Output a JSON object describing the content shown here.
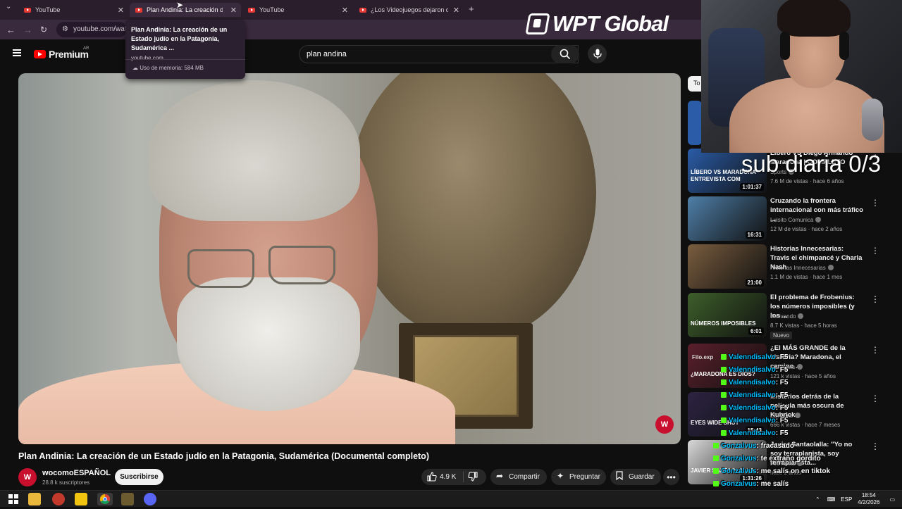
{
  "browser": {
    "tabs": [
      {
        "label": "YouTube"
      },
      {
        "label": "Plan Andinia: La creación de un Estado judío"
      },
      {
        "label": "YouTube"
      },
      {
        "label": "¿Los Videojuegos dejaron de Entretener?"
      }
    ],
    "url": "youtube.com/watch?v=",
    "tooltip": {
      "title": "Plan Andinia: La creación de un Estado judío en la Patagonia, Sudamérica ...",
      "domain": "youtube.com",
      "memory": "Uso de memoria: 584 MB"
    }
  },
  "overlay": {
    "sponsor": "WPT Global",
    "sub_counter": "sub diaria 0/3"
  },
  "youtube": {
    "logo": "Premium",
    "region": "AR",
    "search": {
      "value": "plan andina"
    },
    "video": {
      "title": "Plan Andinia: La creación de un Estado judío en la Patagonia, Sudamérica (Documental completo)",
      "channel": "wocomoESPAÑOL",
      "subscribers": "28.8 k suscriptores",
      "subscribe_label": "Suscribirse",
      "likes": "4.9 K",
      "share_label": "Compartir",
      "ask_label": "Preguntar",
      "save_label": "Guardar",
      "badge": "W"
    },
    "chip": "To",
    "recommendations": [
      {
        "title": "Líbero VS Diego Armando Maradona | COMPLETO",
        "channel": "Sports",
        "meta": "7.6 M de vistas · hace 6 años",
        "duration": "1:01:37",
        "thumb_text": "LÍBERO VS MARADONA ENTREVISTA COM",
        "color": "#2a5ca8"
      },
      {
        "title": "Cruzando la frontera internacional con más tráfico ...",
        "channel": "Luisito Comunica",
        "meta": "12 M de vistas · hace 2 años",
        "duration": "16:31",
        "thumb_text": "",
        "color": "#4e7fa8"
      },
      {
        "title": "Historias Innecesarias: Travis el chimpancé y Charla Nash",
        "channel": "Historias Innecesarias",
        "meta": "1.1 M de vistas · hace 1 mes",
        "duration": "21:00",
        "thumb_text": "",
        "color": "#7a5d3e"
      },
      {
        "title": "El problema de Frobenius: los números imposibles (y los ...",
        "channel": "Derivando",
        "meta": "8.7 K vistas · hace 5 horas",
        "duration": "6:01",
        "thumb_text": "NÚMEROS IMPOSIBLES",
        "color": "#3d5f2a",
        "badge": "Nuevo"
      },
      {
        "title": "¿El MÁS GRANDE de la historia? Maradona, el camino ...",
        "channel": "Filo News",
        "meta": "121 k vistas · hace 5 años",
        "duration": "",
        "thumb_text": "¿MARADONA ES DIOS?",
        "color": "#5b1f2b"
      },
      {
        "title": "Misterios detrás de la película más oscura de Kubrick",
        "channel": "ZEPfilms",
        "meta": "666 k vistas · hace 7 meses",
        "duration": "15:43",
        "thumb_text": "EYES WIDE SHUT",
        "color": "#2c2342"
      },
      {
        "title": "Javier Santaolalla: \"Yo no soy terraplanista, soy terraplanista...",
        "channel": "Filo News",
        "meta": "hace 2 años",
        "duration": "1:31:26",
        "thumb_text": "JAVIER SANTAOLALLA",
        "color": "#d9d9d9"
      }
    ]
  },
  "chat": {
    "ghost": "Filo.exp",
    "lines": [
      {
        "user": "Valenndisalvo",
        "msg": ": F5"
      },
      {
        "user": "Valenndisalvo",
        "msg": ": F5"
      },
      {
        "user": "Valenndisalvo",
        "msg": ": F5"
      },
      {
        "user": "Valenndisalvo",
        "msg": ": F5"
      },
      {
        "user": "Valenndisalvo",
        "msg": ": F5"
      },
      {
        "user": "Valenndisalvo",
        "msg": ": F5"
      },
      {
        "user": "Valenndisalvo",
        "msg": ": F5"
      },
      {
        "user": "Gonzalvus",
        "msg": ": fracasado"
      },
      {
        "user": "Gonzalvus",
        "msg": ": te extraño gordito"
      },
      {
        "user": "Gonzalvus",
        "msg": ": me salís on en tiktok"
      },
      {
        "user": "Gonzalvus",
        "msg": ": me salís"
      }
    ]
  },
  "taskbar": {
    "lang": "ESP",
    "time": "18:54",
    "date": "4/2/2026"
  }
}
